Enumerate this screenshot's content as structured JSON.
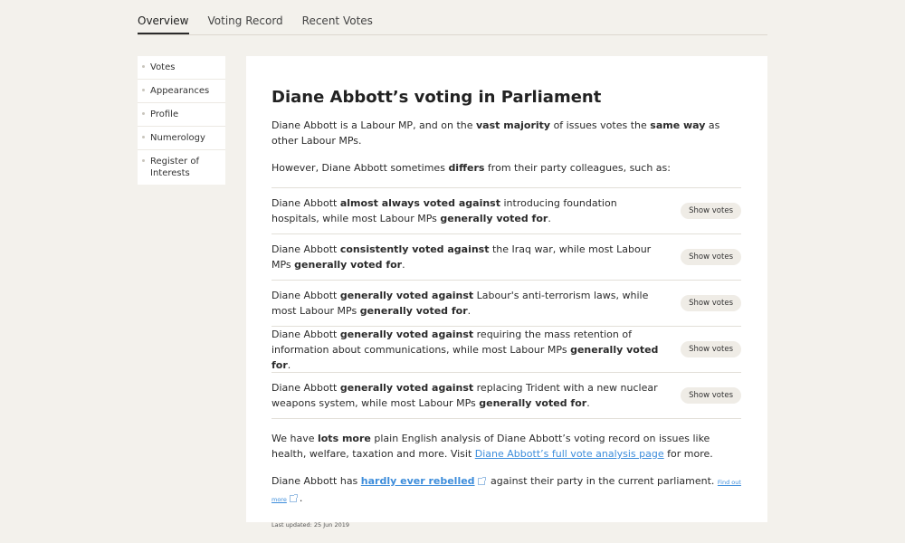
{
  "tabs": [
    {
      "label": "Overview"
    },
    {
      "label": "Voting Record"
    },
    {
      "label": "Recent Votes"
    }
  ],
  "sidebar": {
    "items": [
      {
        "label": "Votes"
      },
      {
        "label": "Appearances"
      },
      {
        "label": "Profile"
      },
      {
        "label": "Numerology"
      },
      {
        "label": "Register of Interests"
      }
    ]
  },
  "main": {
    "title": "Diane Abbott’s voting in Parliament",
    "intro": {
      "p1": "Diane Abbott is a Labour MP, and on the ",
      "b1": "vast majority",
      "p2": " of issues votes the ",
      "b2": "same way",
      "p3": " as other Labour MPs."
    },
    "intro2": {
      "p1": "However, Diane Abbott sometimes ",
      "b1": "differs",
      "p2": " from their party colleagues, such as:"
    },
    "votes": [
      {
        "p1": "Diane Abbott ",
        "b1": "almost always voted against",
        "p2": " introducing foundation hospitals, while most Labour MPs ",
        "b2": "generally voted for",
        "p3": ".",
        "button": "Show votes"
      },
      {
        "p1": "Diane Abbott ",
        "b1": "consistently voted against",
        "p2": " the Iraq war, while most Labour MPs ",
        "b2": "generally voted for",
        "p3": ".",
        "button": "Show votes"
      },
      {
        "p1": "Diane Abbott ",
        "b1": "generally voted against",
        "p2": " Labour's anti-terrorism laws, while most Labour MPs ",
        "b2": "generally voted for",
        "p3": ".",
        "button": "Show votes"
      },
      {
        "p1": "Diane Abbott ",
        "b1": "generally voted against",
        "p2": " requiring the mass retention of information about communications, while most Labour MPs ",
        "b2": "generally voted for",
        "p3": ".",
        "button": "Show votes"
      },
      {
        "p1": "Diane Abbott ",
        "b1": "generally voted against",
        "p2": " replacing Trident with a new nuclear weapons system, while most Labour MPs ",
        "b2": "generally voted for",
        "p3": ".",
        "button": "Show votes"
      }
    ],
    "analysis": {
      "p1": "We have ",
      "b1": "lots more",
      "p2": " plain English analysis of Diane Abbott’s voting record on issues like health, welfare, taxation and more. Visit ",
      "link": "Diane Abbott’s full vote analysis page",
      "p3": " for more."
    },
    "rebel": {
      "p1": "Diane Abbott has ",
      "link": "hardly ever rebelled",
      "p2": " against their party in the current parliament. ",
      "find_out": "Find out more",
      "p3": "."
    },
    "updated": "Last updated: 25 Jun 2019"
  },
  "colors": {
    "background": "#f3f1ec",
    "link": "#3d8ddb",
    "button": "#efece6"
  }
}
